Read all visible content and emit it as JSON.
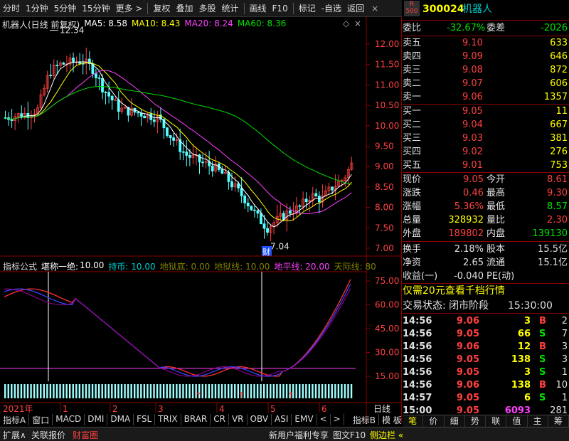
{
  "toolbar": {
    "items": [
      "分时",
      "1分钟",
      "5分钟",
      "15分钟",
      "更多 >",
      "复权",
      "叠加",
      "多股",
      "统计",
      "画线",
      "F10",
      "标记",
      "-自选",
      "返回"
    ]
  },
  "chart": {
    "title": "机器人(日线 前复权)",
    "ma": [
      {
        "label": "MA5: 8.58",
        "color": "#ffffff"
      },
      {
        "label": "MA10: 8.43",
        "color": "#ffff00"
      },
      {
        "label": "MA20: 8.24",
        "color": "#ff40ff"
      },
      {
        "label": "MA60: 8.36",
        "color": "#00e000"
      }
    ],
    "price_ticks": [
      "12.00",
      "11.50",
      "11.00",
      "10.50",
      "10.00",
      "9.50",
      "9.00",
      "8.50",
      "8.00",
      "7.50",
      "7.00"
    ],
    "high_label": "12.34",
    "low_label": "7.04",
    "cai_label": "财",
    "indicator_bar": {
      "formula": "指标公式",
      "name": "堪称一绝:",
      "value": "10.00",
      "items": [
        {
          "t": "持币: 10.00",
          "c": "#00d0d0"
        },
        {
          "t": "地狱底: 0.00",
          "c": "#808000"
        },
        {
          "t": "地狱线: 10.00",
          "c": "#808000"
        },
        {
          "t": "地平线: 20.00",
          "c": "#ff40ff"
        },
        {
          "t": "天际线: 80",
          "c": "#808000"
        }
      ]
    },
    "ind_ticks": [
      "75.00",
      "60.00",
      "45.00",
      "30.00",
      "15.00"
    ],
    "date_labels": [
      "2021年",
      "1",
      "2",
      "3",
      "4",
      "5",
      "6"
    ],
    "period_label": "日线",
    "tabs": [
      "指标A",
      "窗口",
      "MACD",
      "DMI",
      "DMA",
      "FSL",
      "TRIX",
      "BRAR",
      "CR",
      "VR",
      "OBV",
      "ASI",
      "EMV",
      "<",
      ">",
      "指标B",
      "模 板",
      "+",
      "-"
    ]
  },
  "quote": {
    "code": "300024",
    "name": "机器人",
    "mark_top": "R",
    "mark_bottom": "500",
    "weibi_label": "委比",
    "weibi": "-32.67%",
    "weicha_label": "委差",
    "weicha": "-2026",
    "asks": [
      {
        "l": "卖五",
        "p": "9.10",
        "v": "633"
      },
      {
        "l": "卖四",
        "p": "9.09",
        "v": "646"
      },
      {
        "l": "卖三",
        "p": "9.08",
        "v": "872"
      },
      {
        "l": "卖二",
        "p": "9.07",
        "v": "606"
      },
      {
        "l": "卖一",
        "p": "9.06",
        "v": "1357"
      }
    ],
    "bids": [
      {
        "l": "买一",
        "p": "9.05",
        "v": "11"
      },
      {
        "l": "买二",
        "p": "9.04",
        "v": "667"
      },
      {
        "l": "买三",
        "p": "9.03",
        "v": "381"
      },
      {
        "l": "买四",
        "p": "9.02",
        "v": "276"
      },
      {
        "l": "买五",
        "p": "9.01",
        "v": "753"
      }
    ],
    "stats": [
      {
        "l1": "现价",
        "v1": "9.05",
        "c1": "red",
        "l2": "今开",
        "v2": "8.61",
        "c2": "red"
      },
      {
        "l1": "涨跌",
        "v1": "0.46",
        "c1": "red",
        "l2": "最高",
        "v2": "9.30",
        "c2": "red"
      },
      {
        "l1": "涨幅",
        "v1": "5.36%",
        "c1": "red",
        "l2": "最低",
        "v2": "8.57",
        "c2": "grn"
      },
      {
        "l1": "总量",
        "v1": "328932",
        "c1": "yel",
        "l2": "量比",
        "v2": "2.30",
        "c2": "red"
      },
      {
        "l1": "外盘",
        "v1": "189802",
        "c1": "red",
        "l2": "内盘",
        "v2": "139130",
        "c2": "grn"
      }
    ],
    "stats2": [
      {
        "l1": "换手",
        "v1": "2.18%",
        "l2": "股本",
        "v2": "15.5亿"
      },
      {
        "l1": "净资",
        "v1": "2.65",
        "l2": "流通",
        "v2": "15.1亿"
      },
      {
        "l1": "收益(一)",
        "v1": "-0.040",
        "l2": "PE(动)",
        "v2": ""
      }
    ],
    "promo": "仅需20元查看千档行情",
    "status_label": "交易状态: 闭市阶段",
    "status_time": "15:30:00",
    "ticks": [
      {
        "t": "14:56",
        "p": "9.06",
        "v": "3",
        "s": "B",
        "n": "2"
      },
      {
        "t": "14:56",
        "p": "9.05",
        "v": "66",
        "s": "S",
        "n": "7"
      },
      {
        "t": "14:56",
        "p": "9.06",
        "v": "12",
        "s": "B",
        "n": "3"
      },
      {
        "t": "14:56",
        "p": "9.05",
        "v": "138",
        "s": "S",
        "n": "3"
      },
      {
        "t": "14:56",
        "p": "9.05",
        "v": "3",
        "s": "S",
        "n": "1"
      },
      {
        "t": "14:56",
        "p": "9.06",
        "v": "138",
        "s": "B",
        "n": "10"
      },
      {
        "t": "14:57",
        "p": "9.05",
        "v": "6",
        "s": "S",
        "n": "1"
      },
      {
        "t": "15:00",
        "p": "9.05",
        "v": "6093",
        "s": "",
        "n": "281"
      }
    ],
    "bottom_tabs": [
      "笔",
      "价",
      "细",
      "势",
      "联",
      "值",
      "主",
      "筹"
    ]
  },
  "bottombar": {
    "left": [
      "扩展∧",
      "关联报价",
      "财富圈"
    ],
    "right": [
      "新用户福利专享",
      "图文F10",
      "侧边栏 «"
    ]
  }
}
